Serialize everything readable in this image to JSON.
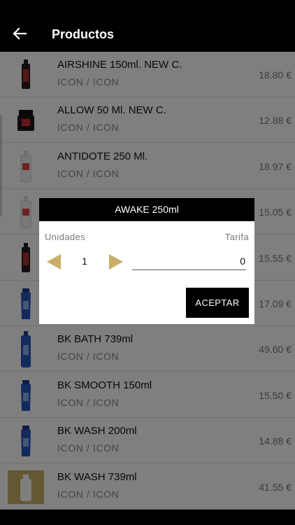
{
  "app": {
    "title": "Productos"
  },
  "products": [
    {
      "name": "AIRSHINE 150ml. NEW C.",
      "brand": "ICON / ICON",
      "price": "18.80 €",
      "thumb": "spray-bottle-icon"
    },
    {
      "name": "ALLOW 50 Ml. NEW C.",
      "brand": "ICON / ICON",
      "price": "12.88 €",
      "thumb": "jar-icon"
    },
    {
      "name": "ANTIDOTE 250 Ml.",
      "brand": "ICON / ICON",
      "price": "18.97 €",
      "thumb": "bottle-icon"
    },
    {
      "name": "",
      "brand": "",
      "price": "15.05 €",
      "thumb": "bottle-icon"
    },
    {
      "name": "",
      "brand": "",
      "price": "15.55 €",
      "thumb": "spray-bottle-icon"
    },
    {
      "name": "",
      "brand": "",
      "price": "17.09 €",
      "thumb": "tube-icon"
    },
    {
      "name": "BK BATH 739ml",
      "brand": "ICON / ICON",
      "price": "49.60 €",
      "thumb": "tall-bottle-icon"
    },
    {
      "name": "BK SMOOTH  150ml",
      "brand": "ICON / ICON",
      "price": "15.50 €",
      "thumb": "tube-icon"
    },
    {
      "name": "BK WASH 200ml",
      "brand": "ICON / ICON",
      "price": "14.88 €",
      "thumb": "tube-icon"
    },
    {
      "name": "BK WASH 739ml",
      "brand": "ICON / ICON",
      "price": "41.55 €",
      "thumb": "placeholder-bottle-icon"
    }
  ],
  "dialog": {
    "title": "AWAKE 250ml",
    "units_label": "Unidades",
    "rate_label": "Tarifa",
    "quantity": "1",
    "rate_value": "0",
    "accept_label": "ACEPTAR"
  },
  "colors": {
    "accent_gold": "#c9ae68",
    "header_bg": "#000000",
    "dialog_header_bg": "#000000"
  }
}
